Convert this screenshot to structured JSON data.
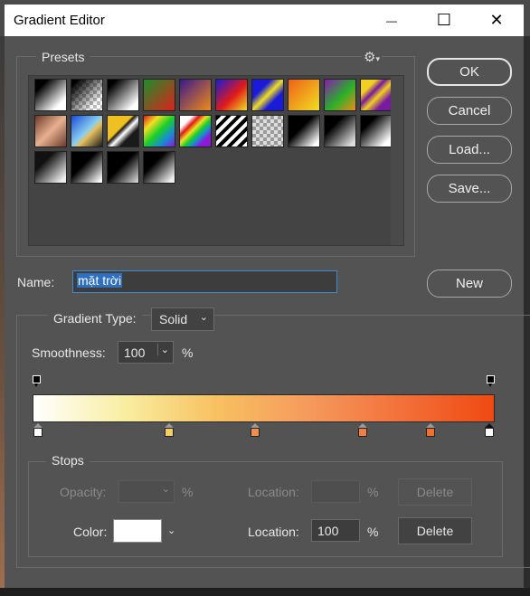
{
  "window": {
    "title": "Gradient Editor",
    "minimize_glyph": "—",
    "maximize_glyph": "☐",
    "close_glyph": "✕"
  },
  "presets": {
    "label": "Presets",
    "gear_glyph": "⚙",
    "gear_icon": "gear-icon",
    "swatches": [
      {
        "bg": "linear-gradient(135deg,#000 20%,#fff 80%)"
      },
      {
        "bg": "linear-gradient(135deg,#000 10%,transparent 80%),repeating-conic-gradient(#bbb 0 25%,#fff 0 50%) 0 0/8px 8px"
      },
      {
        "bg": "linear-gradient(135deg,#000 15%,#fff 85%)"
      },
      {
        "bg": "linear-gradient(135deg,#1a8f2a,#e0201a)"
      },
      {
        "bg": "linear-gradient(135deg,#3a1a8a,#f08a1a)"
      },
      {
        "bg": "linear-gradient(135deg,#1a1ad8,#e01a1a 55%,#f0e020)"
      },
      {
        "bg": "linear-gradient(135deg,#1a1ad8 30%,#f0e020 50%,#1a1ad8 70%)"
      },
      {
        "bg": "linear-gradient(135deg,#f0601a,#f0e020)"
      },
      {
        "bg": "linear-gradient(135deg,#8a1ab0,#2ab02a 55%,#f08a1a)"
      },
      {
        "bg": "linear-gradient(135deg,#f0d020 25%,#7a1aa0 40%,#f0d020 55%,#7a1aa0 75%)"
      },
      {
        "bg": "linear-gradient(135deg,#6a3a2a,#e8b090 50%,#6a3a2a)"
      },
      {
        "bg": "linear-gradient(135deg,#1a4ad8,#8ad0f0 50%,#e8c060 60%,#1a1a1a)"
      },
      {
        "bg": "linear-gradient(135deg,#f0c020 40%,#1a1a1a 45%,#fff 55%,#1a1a1a 70%)"
      },
      {
        "bg": "linear-gradient(135deg,#e01a1a,#f0e020,#1ad02a,#1a8ad8,#8a1ad8)"
      },
      {
        "bg": "linear-gradient(135deg,#fff 20%,#e01a1a,#f0e020,#1ad02a,#1a8ad8,#8a1ad8 80%)"
      },
      {
        "bg": "repeating-linear-gradient(135deg,#000 0 4px,#fff 4px 8px)"
      },
      {
        "bg": "repeating-conic-gradient(#999 0 25%,#ddd 0 50%) 0 0/8px 8px"
      },
      {
        "bg": "linear-gradient(135deg,#000 40%,#fff 90%)"
      },
      {
        "bg": "linear-gradient(135deg,#000 30%,#ddd 90%)"
      },
      {
        "bg": "linear-gradient(135deg,#000 25%,#fff 85%)"
      },
      {
        "bg": "linear-gradient(135deg,#111 30%,#eee 90%)"
      },
      {
        "bg": "linear-gradient(135deg,#000 40%,#fff 95%)"
      },
      {
        "bg": "linear-gradient(135deg,#000 45%,#ccc 95%)"
      },
      {
        "bg": "linear-gradient(135deg,#000 35%,#eee 90%)"
      }
    ]
  },
  "buttons": {
    "ok": "OK",
    "cancel": "Cancel",
    "load": "Load...",
    "save": "Save...",
    "new": "New"
  },
  "name": {
    "label": "Name:",
    "value": "mặt trời"
  },
  "gradient": {
    "type_label": "Gradient Type:",
    "type_value": "Solid",
    "smoothness_label": "Smoothness:",
    "smoothness_value": "100",
    "smoothness_unit": "%",
    "bar_colors": [
      "#ffffff",
      "#f8eea0",
      "#f8c060",
      "#f59a5c",
      "#f3703a",
      "#ee4a10"
    ],
    "opacity_stops": [
      {
        "location": 0,
        "color": "#000000"
      },
      {
        "location": 100,
        "color": "#000000"
      }
    ],
    "color_stops": [
      {
        "location": 0,
        "color": "#ffffff"
      },
      {
        "location": 29,
        "color": "#f5d060"
      },
      {
        "location": 48,
        "color": "#f09050"
      },
      {
        "location": 72,
        "color": "#f08040"
      },
      {
        "location": 87,
        "color": "#f07030"
      },
      {
        "location": 100,
        "color": "#ffffff",
        "selected": true
      }
    ]
  },
  "stops": {
    "label": "Stops",
    "opacity_label": "Opacity:",
    "opacity_unit": "%",
    "opacity_location_label": "Location:",
    "opacity_location_unit": "%",
    "opacity_delete": "Delete",
    "color_label": "Color:",
    "color_value": "#ffffff",
    "color_location_label": "Location:",
    "color_location_value": "100",
    "color_location_unit": "%",
    "color_delete": "Delete"
  }
}
